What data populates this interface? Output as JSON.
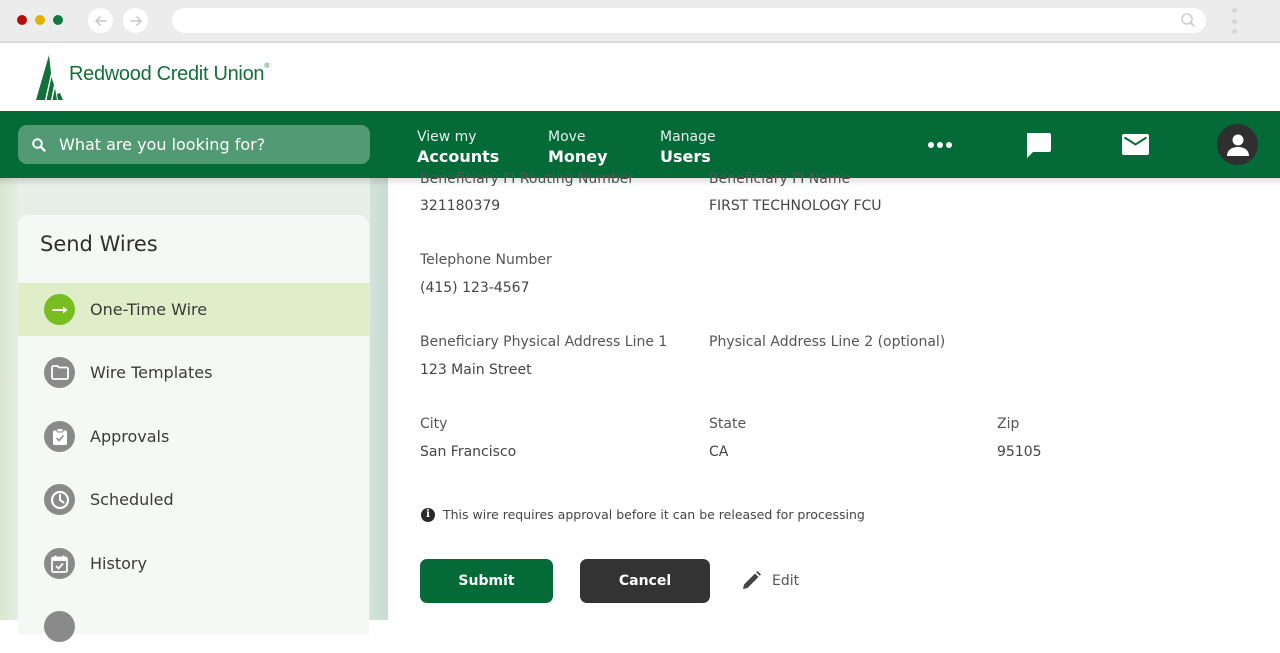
{
  "browser": {
    "url": ""
  },
  "brand": {
    "name": "Redwood Credit Union",
    "tm": "®",
    "primary_color": "#046a38",
    "accent_color": "#78be20"
  },
  "navbar": {
    "search_placeholder": "What are you looking for?",
    "menu": [
      {
        "small": "View my",
        "big": "Accounts"
      },
      {
        "small": "Move",
        "big": "Money"
      },
      {
        "small": "Manage",
        "big": "Users"
      }
    ],
    "icons": [
      "more-icon",
      "chat-icon",
      "mail-icon",
      "profile-icon"
    ]
  },
  "sidebar": {
    "title": "Send Wires",
    "items": [
      {
        "label": "One-Time Wire",
        "icon": "arrow-right-icon",
        "active": true
      },
      {
        "label": "Wire Templates",
        "icon": "folder-icon",
        "active": false
      },
      {
        "label": "Approvals",
        "icon": "clipboard-check-icon",
        "active": false
      },
      {
        "label": "Scheduled",
        "icon": "clock-icon",
        "active": false
      },
      {
        "label": "History",
        "icon": "calendar-check-icon",
        "active": false
      }
    ]
  },
  "form": {
    "routing_label": "Beneficiary FI Routing Number",
    "routing_value": "321180379",
    "fi_name_label": "Beneficiary FI Name",
    "fi_name_value": "FIRST TECHNOLOGY FCU",
    "phone_label": "Telephone Number",
    "phone_value": "(415) 123-4567",
    "address1_label": "Beneficiary Physical Address Line 1",
    "address1_value": "123 Main Street",
    "address2_label": "Physical Address Line 2 (optional)",
    "address2_value": "",
    "city_label": "City",
    "city_value": "San Francisco",
    "state_label": "State",
    "state_value": "CA",
    "zip_label": "Zip",
    "zip_value": "95105"
  },
  "notice": {
    "icon": "info-icon",
    "text": "This wire requires approval before it can be released for processing"
  },
  "actions": {
    "submit_label": "Submit",
    "cancel_label": "Cancel",
    "edit_label": "Edit"
  }
}
